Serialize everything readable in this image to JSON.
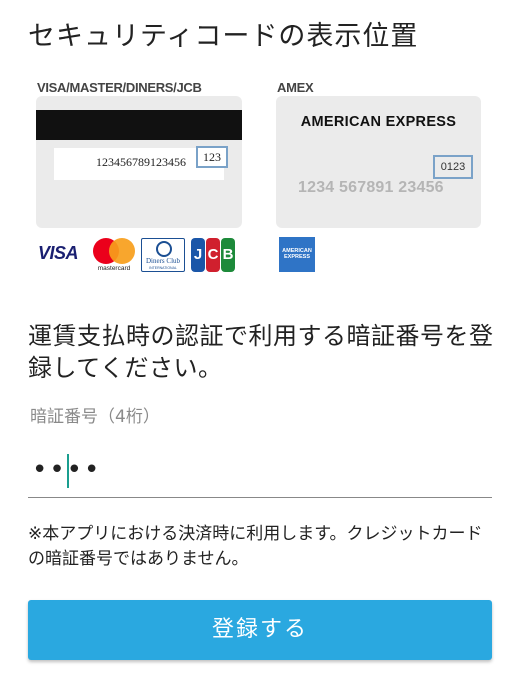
{
  "title": "セキュリティコードの表示位置",
  "cards": {
    "visa_label": "VISA/MASTER/DINERS/JCB",
    "visa_card_number": "123456789123456",
    "visa_cvv": "123",
    "amex_label": "AMEX",
    "amex_name": "AMERICAN EXPRESS",
    "amex_cvv": "0123",
    "amex_card_number": "1234 567891 23456"
  },
  "brands": {
    "visa": "VISA",
    "mastercard": "mastercard",
    "diners": "Diners Club",
    "diners_sub": "INTERNATIONAL",
    "jcb": [
      "J",
      "C",
      "B"
    ],
    "amex": "AMERICAN EXPRESS"
  },
  "pin": {
    "heading": "運賃支払時の認証で利用する暗証番号を登録してください。",
    "label": "暗証番号（4桁）",
    "masked_value": "••••"
  },
  "note": "※本アプリにおける決済時に利用します。クレジットカードの暗証番号ではありません。",
  "submit_label": "登録する",
  "colors": {
    "button": "#2aa8e0",
    "caret": "#1a9e8f",
    "cvv_border": "#7aa2c8"
  }
}
